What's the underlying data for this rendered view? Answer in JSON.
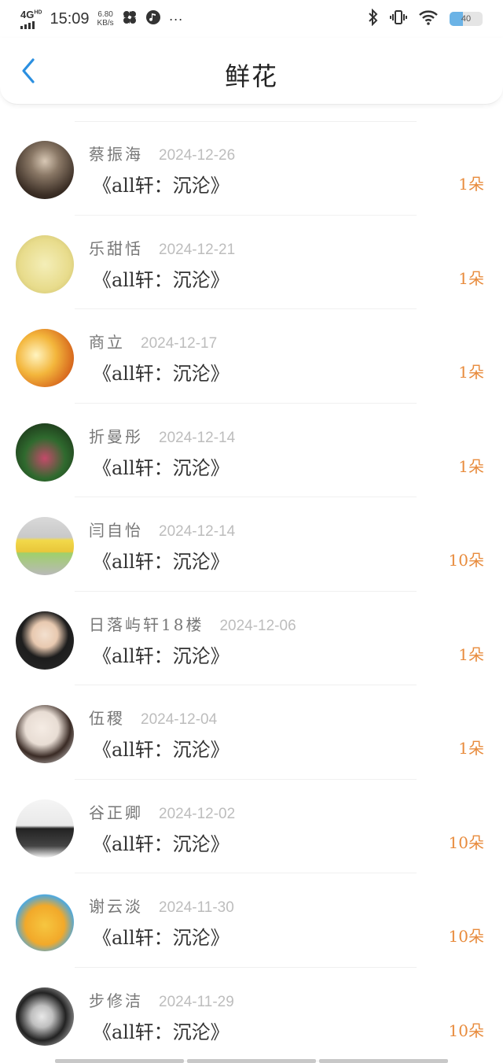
{
  "status_bar": {
    "network": "4G",
    "network_sup": "HD",
    "time": "15:09",
    "speed_value": "6.80",
    "speed_unit": "KB/s",
    "more": "···",
    "battery": "40",
    "battery_level": 0.4,
    "icons": [
      "pinwheel-icon",
      "music-note-icon",
      "bluetooth-icon",
      "vibrate-icon",
      "wifi-icon"
    ]
  },
  "header": {
    "title": "鲜花",
    "back_icon": "chevron-left-icon",
    "accent": "#2b8fe0"
  },
  "colors": {
    "amount": "#e88b3c",
    "name": "#777777",
    "date": "#bdbdbd"
  },
  "records": [
    {
      "name": "蔡振海",
      "date": "2024-12-26",
      "work": "《all轩：沉沦》",
      "amount": "1朵"
    },
    {
      "name": "乐甜恬",
      "date": "2024-12-21",
      "work": "《all轩：沉沦》",
      "amount": "1朵"
    },
    {
      "name": "商立",
      "date": "2024-12-17",
      "work": "《all轩：沉沦》",
      "amount": "1朵"
    },
    {
      "name": "折曼彤",
      "date": "2024-12-14",
      "work": "《all轩：沉沦》",
      "amount": "1朵"
    },
    {
      "name": "闫自怡",
      "date": "2024-12-14",
      "work": "《all轩：沉沦》",
      "amount": "10朵"
    },
    {
      "name": "日落屿轩18楼",
      "date": "2024-12-06",
      "work": "《all轩：沉沦》",
      "amount": "1朵"
    },
    {
      "name": "伍稷",
      "date": "2024-12-04",
      "work": "《all轩：沉沦》",
      "amount": "1朵"
    },
    {
      "name": "谷正卿",
      "date": "2024-12-02",
      "work": "《all轩：沉沦》",
      "amount": "10朵"
    },
    {
      "name": "谢云淡",
      "date": "2024-11-30",
      "work": "《all轩：沉沦》",
      "amount": "10朵"
    },
    {
      "name": "步修洁",
      "date": "2024-11-29",
      "work": "《all轩：沉沦》",
      "amount": "10朵"
    }
  ]
}
